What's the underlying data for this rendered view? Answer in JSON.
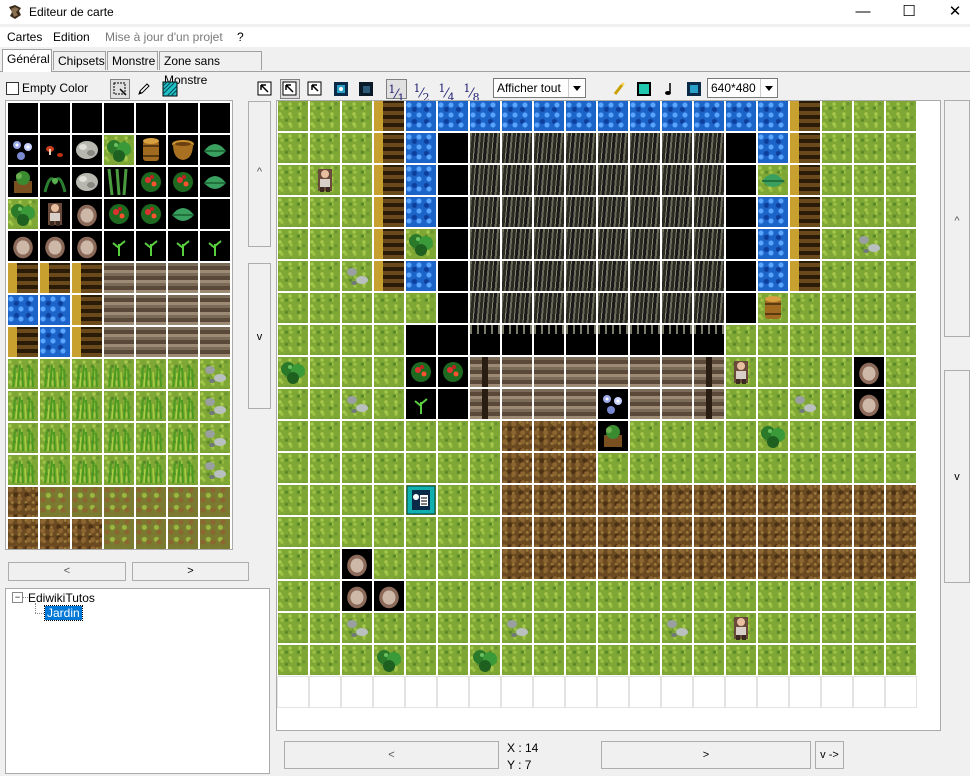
{
  "window": {
    "title": "Editeur de carte",
    "minimize_glyph": "—",
    "maximize_glyph": "☐",
    "close_glyph": "✕"
  },
  "menu": {
    "items": [
      "Cartes",
      "Edition",
      "Mise à jour d'un projet",
      "?"
    ]
  },
  "tabs": [
    "Général",
    "Chipsets",
    "Monstre",
    "Zone sans Monstre"
  ],
  "left_panel": {
    "empty_color_label": "Empty Color",
    "scroll_up": "^",
    "scroll_down": "v",
    "nav_prev": "<",
    "nav_next": ">"
  },
  "toolbar": {
    "zoom_levels": [
      "1",
      "2",
      "4",
      "8"
    ],
    "display_select": "Afficher tout",
    "resolution_select": "640*480"
  },
  "tree": {
    "root": "EdiwikiTutos",
    "child": "Jardin"
  },
  "map_nav": {
    "scroll_up": "^",
    "scroll_down": "v",
    "prev": "<",
    "next": ">",
    "layer_button": "v ->"
  },
  "status": {
    "x_label": "X : 14",
    "y_label": "Y : 7"
  },
  "chipset_tiles": [
    "black",
    "black",
    "black",
    "black",
    "black",
    "black",
    "black",
    "flowers",
    "mushroom",
    "stones",
    "bush",
    "barrel",
    "pot",
    "leaf",
    "plant",
    "vinebush",
    "stones",
    "vines",
    "berry",
    "berry",
    "leaf",
    "bush",
    "person",
    "rock",
    "berry",
    "berry",
    "leaf",
    "black",
    "rock",
    "rock",
    "rock",
    "sprout",
    "sprout",
    "sprout",
    "sprout",
    "cliff",
    "cliff",
    "cliff",
    "fence",
    "fence",
    "fence",
    "fence",
    "water",
    "water",
    "cliff",
    "fence",
    "fence",
    "fence",
    "fence",
    "cliff",
    "water",
    "cliff",
    "fence",
    "fence",
    "fence",
    "fence",
    "tallgrass",
    "tallgrass",
    "tallgrass",
    "tallgrass",
    "tallgrass",
    "tallgrass",
    "pebble",
    "tallgrass",
    "tallgrass",
    "tallgrass",
    "tallgrass",
    "tallgrass",
    "tallgrass",
    "pebble",
    "tallgrass",
    "tallgrass",
    "tallgrass",
    "tallgrass",
    "tallgrass",
    "tallgrass",
    "pebble",
    "tallgrass",
    "tallgrass",
    "tallgrass",
    "tallgrass",
    "tallgrass",
    "tallgrass",
    "pebble",
    "dirt",
    "dirtg",
    "dirtg",
    "dirtg",
    "dirtg",
    "dirtg",
    "dirtg",
    "dirt",
    "dirt",
    "dirt",
    "dirtg",
    "dirtg",
    "dirtg",
    "dirtg"
  ],
  "map_tiles": [
    [
      "grass",
      "grass",
      "grass",
      "cliff",
      "water",
      "water",
      "water",
      "water",
      "water",
      "water",
      "water",
      "water",
      "water",
      "water",
      "water",
      "water",
      "cliff",
      "grass",
      "grass",
      "grass"
    ],
    [
      "grass",
      "grass",
      "grass",
      "cliff",
      "water",
      "black",
      "hay",
      "hay",
      "hay",
      "hay",
      "hay",
      "hay",
      "hay",
      "hay",
      "black",
      "water",
      "cliff",
      "grass",
      "grass",
      "grass"
    ],
    [
      "grass",
      "person",
      "grass",
      "cliff",
      "water",
      "black",
      "hay",
      "hay",
      "hay",
      "hay",
      "hay",
      "hay",
      "hay",
      "hay",
      "black",
      "leaf",
      "cliff",
      "grass",
      "grass",
      "grass"
    ],
    [
      "grass",
      "grass",
      "grass",
      "cliff",
      "water",
      "black",
      "hay",
      "hay",
      "hay",
      "hay",
      "hay",
      "hay",
      "hay",
      "hay",
      "black",
      "water",
      "cliff",
      "grass",
      "grass",
      "grass"
    ],
    [
      "grass",
      "grass",
      "grass",
      "cliff",
      "bush",
      "black",
      "hay",
      "hay",
      "hay",
      "hay",
      "hay",
      "hay",
      "hay",
      "hay",
      "black",
      "water",
      "cliff",
      "grass",
      "pebble",
      "grass"
    ],
    [
      "grass",
      "grass",
      "pebble",
      "cliff",
      "water",
      "black",
      "hay",
      "hay",
      "hay",
      "hay",
      "hay",
      "hay",
      "hay",
      "hay",
      "black",
      "water",
      "cliff",
      "grass",
      "grass",
      "grass"
    ],
    [
      "grass",
      "grass",
      "grass",
      "grass",
      "grass",
      "black",
      "hay",
      "hay",
      "hay",
      "hay",
      "hay",
      "hay",
      "hay",
      "hay",
      "black",
      "barrel",
      "grass",
      "grass",
      "grass",
      "grass"
    ],
    [
      "grass",
      "grass",
      "grass",
      "grass",
      "black",
      "black",
      "hayedge",
      "hayedge",
      "hayedge",
      "hayedge",
      "hayedge",
      "hayedge",
      "hayedge",
      "hayedge",
      "grass",
      "grass",
      "grass",
      "grass",
      "grass",
      "grass"
    ],
    [
      "bush",
      "grass",
      "grass",
      "grass",
      "berry",
      "berry",
      "fencev",
      "fence",
      "fence",
      "fence",
      "fence",
      "fence",
      "fence",
      "fencev",
      "person",
      "grass",
      "grass",
      "grass",
      "rock",
      "grass"
    ],
    [
      "grass",
      "grass",
      "pebble",
      "grass",
      "sprout",
      "black",
      "fencev",
      "fence",
      "fence",
      "fence",
      "flowers",
      "fence",
      "fence",
      "fencev",
      "grass",
      "grass",
      "pebble",
      "grass",
      "rock",
      "grass"
    ],
    [
      "grass",
      "grass",
      "grass",
      "grass",
      "grass",
      "grass",
      "grass",
      "dirt",
      "dirt",
      "dirt",
      "plant",
      "grass",
      "grass",
      "grass",
      "grass",
      "bush",
      "grass",
      "grass",
      "grass",
      "grass"
    ],
    [
      "grass",
      "grass",
      "grass",
      "grass",
      "grass",
      "grass",
      "grass",
      "dirt",
      "dirt",
      "dirt",
      "grass",
      "grass",
      "grass",
      "grass",
      "grass",
      "grass",
      "grass",
      "grass",
      "grass",
      "grass"
    ],
    [
      "grass",
      "grass",
      "grass",
      "grass",
      "event",
      "grass",
      "grass",
      "dirt",
      "dirt",
      "dirt",
      "dirt",
      "dirt",
      "dirt",
      "dirt",
      "dirt",
      "dirt",
      "dirt",
      "dirt",
      "dirt",
      "dirt"
    ],
    [
      "grass",
      "grass",
      "grass",
      "grass",
      "grass",
      "grass",
      "grass",
      "dirt",
      "dirt",
      "dirt",
      "dirt",
      "dirt",
      "dirt",
      "dirt",
      "dirt",
      "dirt",
      "dirt",
      "dirt",
      "dirt",
      "dirt"
    ],
    [
      "grass",
      "grass",
      "rock",
      "grass",
      "grass",
      "grass",
      "grass",
      "dirt",
      "dirt",
      "dirt",
      "dirt",
      "dirt",
      "dirt",
      "dirt",
      "dirt",
      "dirt",
      "dirt",
      "dirt",
      "dirt",
      "dirt"
    ],
    [
      "grass",
      "grass",
      "rock",
      "rock",
      "grass",
      "grass",
      "grass",
      "grass",
      "grass",
      "grass",
      "grass",
      "grass",
      "grass",
      "grass",
      "grass",
      "grass",
      "grass",
      "grass",
      "grass",
      "grass"
    ],
    [
      "grass",
      "grass",
      "pebble",
      "grass",
      "grass",
      "grass",
      "grass",
      "pebble",
      "grass",
      "grass",
      "grass",
      "grass",
      "pebble",
      "grass",
      "person",
      "grass",
      "grass",
      "grass",
      "grass",
      "grass"
    ],
    [
      "grass",
      "grass",
      "grass",
      "bush",
      "grass",
      "grass",
      "bush",
      "grass",
      "grass",
      "grass",
      "grass",
      "grass",
      "grass",
      "grass",
      "grass",
      "grass",
      "grass",
      "grass",
      "grass",
      "grass"
    ],
    [
      "empty",
      "empty",
      "empty",
      "empty",
      "empty",
      "empty",
      "empty",
      "empty",
      "empty",
      "empty",
      "empty",
      "empty",
      "empty",
      "empty",
      "empty",
      "empty",
      "empty",
      "empty",
      "empty",
      "empty"
    ]
  ]
}
